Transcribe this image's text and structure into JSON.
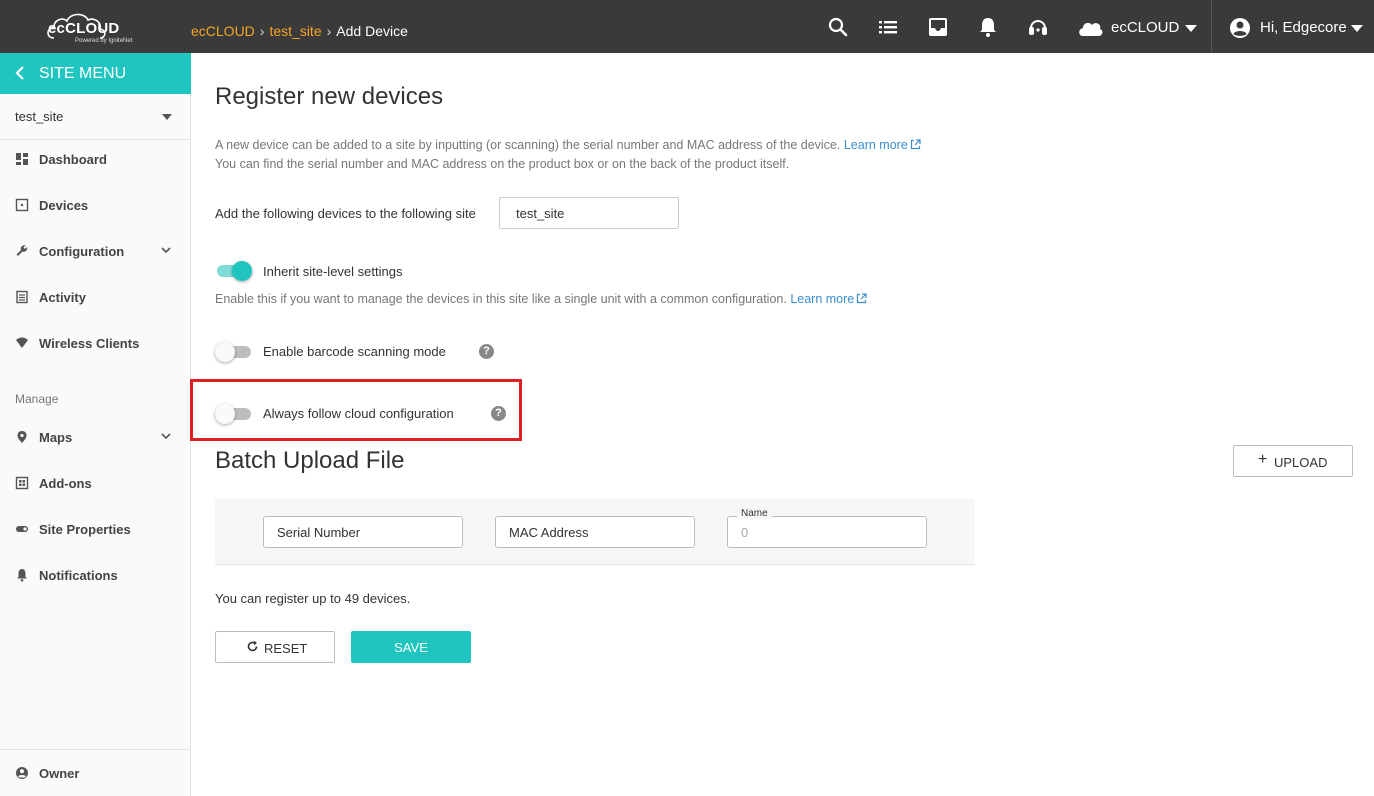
{
  "topbar": {
    "logo_text": "ecCLOUD",
    "logo_sub": "Powered by IgniteNet",
    "breadcrumbs": [
      "ecCLOUD",
      "test_site",
      "Add Device"
    ],
    "site_label": "ecCLOUD",
    "user_label": "Hi, Edgecore"
  },
  "sidebar": {
    "header": "SITE MENU",
    "site": "test_site",
    "items": {
      "dashboard": "Dashboard",
      "devices": "Devices",
      "configuration": "Configuration",
      "activity": "Activity",
      "wireless": "Wireless Clients",
      "maps": "Maps",
      "addons": "Add-ons",
      "site_properties": "Site Properties",
      "notifications": "Notifications",
      "owner": "Owner"
    },
    "section_manage": "Manage"
  },
  "main": {
    "title": "Register new devices",
    "desc_line1": "A new device can be added to a site by inputting (or scanning) the serial number and MAC address of the device.",
    "learn_more": "Learn more",
    "desc_line2": "You can find the serial number and MAC address on the product box or on the back of the product itself.",
    "site_row_label": "Add the following devices to the following site",
    "site_value": "test_site",
    "inherit_label": "Inherit site-level settings",
    "inherit_on": true,
    "inherit_desc": "Enable this if you want to manage the devices in this site like a single unit with a common configuration.",
    "barcode_label": "Enable barcode scanning mode",
    "barcode_on": false,
    "cloud_label": "Always follow cloud configuration",
    "cloud_on": false,
    "help": "?",
    "batch_title": "Batch Upload File",
    "upload_label": "UPLOAD",
    "serial_placeholder": "Serial Number",
    "mac_placeholder": "MAC Address",
    "name_legend": "Name",
    "name_value": "0",
    "limit_text": "You can register up to 49 devices.",
    "reset_label": "RESET",
    "save_label": "SAVE"
  },
  "colors": {
    "accent": "#20c5c0",
    "topbar": "#3a3a3a",
    "breadcrumb_link": "#f5a623",
    "link": "#3a8fd1",
    "highlight": "#e02020"
  }
}
